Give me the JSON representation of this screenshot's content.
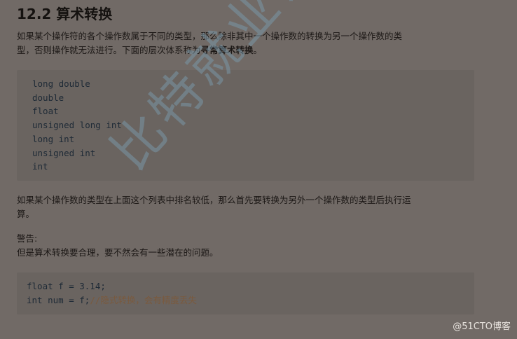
{
  "section_title": "12.2 算术转换",
  "intro": {
    "line1": "如果某个操作符的各个操作数属于不同的类型，那么除非其中一个操作数的转换为另一个操作数的类",
    "line2_prefix": "型，否则操作就无法进行。下面的层次体系称为",
    "line2_bold": "寻常算术转换",
    "line2_suffix": "。"
  },
  "hierarchy_code": [
    "long double",
    "double",
    "float",
    "unsigned long int",
    "long int",
    "unsigned int",
    "int"
  ],
  "rule": {
    "line1": "如果某个操作数的类型在上面这个列表中排名较低，那么首先要转换为另外一个操作数的类型后执行运",
    "line2": "算。"
  },
  "warning": {
    "label": "警告:",
    "text": "但是算术转换要合理，要不然会有一些潜在的问题。"
  },
  "example_code": {
    "line1": "float f = 3.14;",
    "line2_code": "int num = f;",
    "line2_comment": "//隐式转换，会有精度丢失"
  },
  "watermark_text": "比特就业课",
  "credit": "@51CTO博客"
}
